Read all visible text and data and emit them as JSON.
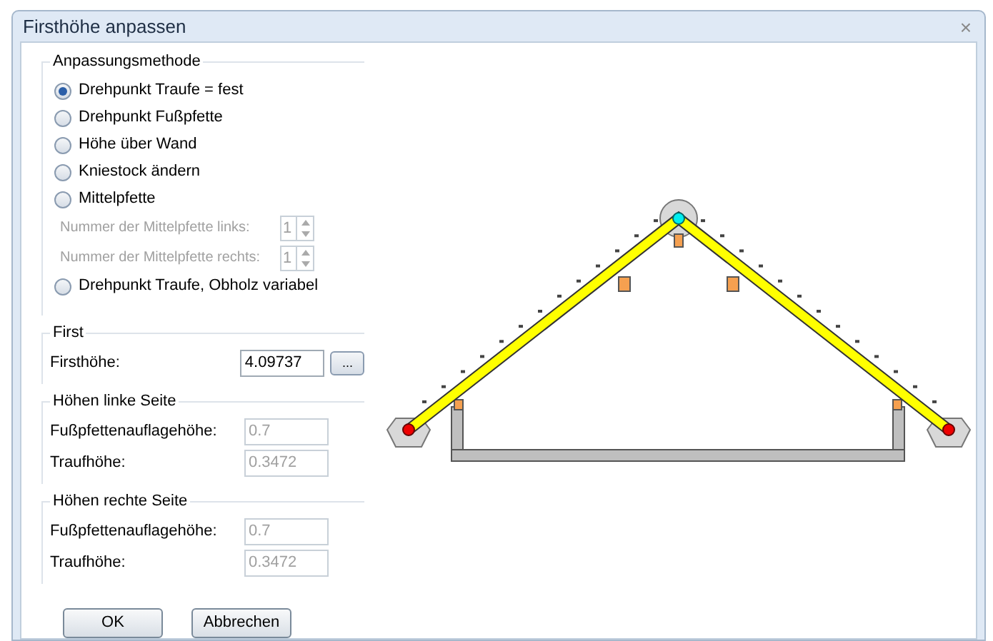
{
  "window": {
    "title": "Firsthöhe anpassen",
    "close": "×"
  },
  "method": {
    "legend": "Anpassungsmethode",
    "items": [
      {
        "kind": "radio",
        "label": "Drehpunkt Traufe = fest",
        "selected": true
      },
      {
        "kind": "radio",
        "label": "Drehpunkt Fußpfette",
        "selected": false
      },
      {
        "kind": "radio",
        "label": "Höhe über Wand",
        "selected": false
      },
      {
        "kind": "radio",
        "label": "Kniestock ändern",
        "selected": false
      },
      {
        "kind": "radio",
        "label": "Mittelpfette",
        "selected": false
      },
      {
        "kind": "spinner",
        "label": "Nummer der Mittelpfette links:",
        "value": "1",
        "disabled": true
      },
      {
        "kind": "spinner",
        "label": "Nummer der Mittelpfette rechts:",
        "value": "1",
        "disabled": true
      },
      {
        "kind": "radio",
        "label": "Drehpunkt Traufe, Obholz variabel",
        "selected": false
      }
    ]
  },
  "groups": [
    {
      "legend": "First",
      "fields": [
        {
          "label": "Firsthöhe:",
          "value": "4.09737",
          "disabled": false,
          "browse": "..."
        }
      ]
    },
    {
      "legend": "Höhen linke Seite",
      "fields": [
        {
          "label": "Fußpfettenauflagehöhe:",
          "value": "0.7",
          "disabled": true
        },
        {
          "label": "Traufhöhe:",
          "value": "0.3472",
          "disabled": true
        }
      ]
    },
    {
      "legend": "Höhen rechte Seite",
      "fields": [
        {
          "label": "Fußpfettenauflagehöhe:",
          "value": "0.7",
          "disabled": true
        },
        {
          "label": "Traufhöhe:",
          "value": "0.3472",
          "disabled": true
        }
      ]
    }
  ],
  "buttons": [
    "OK",
    "Abbrechen"
  ]
}
